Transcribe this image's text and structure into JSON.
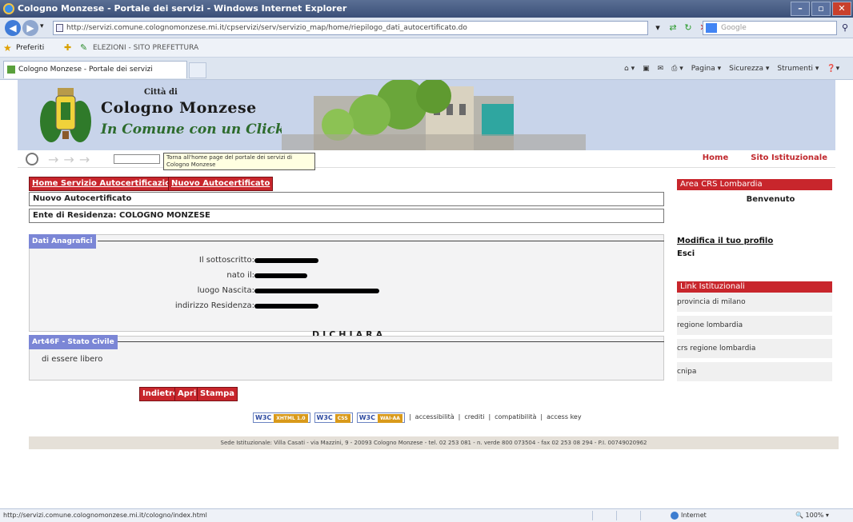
{
  "window": {
    "title": "Cologno Monzese - Portale dei servizi - Windows Internet Explorer",
    "address": "http://servizi.comune.colognomonzese.mi.it/cpservizi/serv/servizio_map/home/riepilogo_dati_autocertificato.do",
    "search_placeholder": "Google",
    "favorites_label": "Preferiti",
    "favorites_link": "ELEZIONI - SITO PREFETTURA",
    "tab_label": "Cologno Monzese - Portale dei servizi",
    "command_items": [
      "Pagina ▾",
      "Sicurezza ▾",
      "Strumenti ▾"
    ],
    "status_url": "http://servizi.comune.colognomonzese.mi.it/cologno/index.html",
    "status_zone": "Internet",
    "status_zoom": "100%"
  },
  "banner": {
    "city_small": "Città di",
    "city_big": "Cologno Monzese",
    "slogan": "In Comune con un Click"
  },
  "topnav": {
    "tooltip": "Torna all'home page del portale dei servizi di Cologno Monzese",
    "home": "Home",
    "site": "Sito Istituzionale"
  },
  "tabs": {
    "home_service": "Home Servizio Autocertificazione",
    "new": "Nuovo Autocertificato"
  },
  "bars": {
    "new_title": "Nuovo Autocertificato",
    "residence": "Ente di Residenza: COLOGNO MONZESE"
  },
  "personal": {
    "title": "Dati Anagrafici",
    "fields": [
      {
        "label": "Il sottoscritto:"
      },
      {
        "label": "nato il:"
      },
      {
        "label": "luogo Nascita:"
      },
      {
        "label": "indirizzo Residenza:"
      }
    ]
  },
  "declaration": {
    "heading": "DICHIARA",
    "section_title": "Art46F - Stato Civile",
    "text": "di essere libero"
  },
  "actions": {
    "back": "Indietro",
    "open": "Apri",
    "print": "Stampa"
  },
  "footer": {
    "badges": [
      {
        "label": "W3C",
        "tag": "XHTML 1.0"
      },
      {
        "label": "W3C",
        "tag": "CSS"
      },
      {
        "label": "W3C",
        "tag": "WAI-AA"
      }
    ],
    "links": [
      "accessibilità",
      "crediti",
      "compatibilità",
      "access key"
    ],
    "address": "Sede Istituzionale: Villa Casati - via Mazzini, 9 - 20093 Cologno Monzese - tel. 02 253 081 - n. verde 800 073504 - fax 02 253 08 294 - P.I. 00749020962"
  },
  "sidebar": {
    "area_title": "Area CRS Lombardia",
    "welcome": "Benvenuto",
    "profile": "Modifica il tuo profilo",
    "exit": "Esci",
    "links_title": "Link Istituzionali",
    "links": [
      "provincia di milano",
      "regione lombardia",
      "crs regione lombardia",
      "cnipa"
    ]
  }
}
